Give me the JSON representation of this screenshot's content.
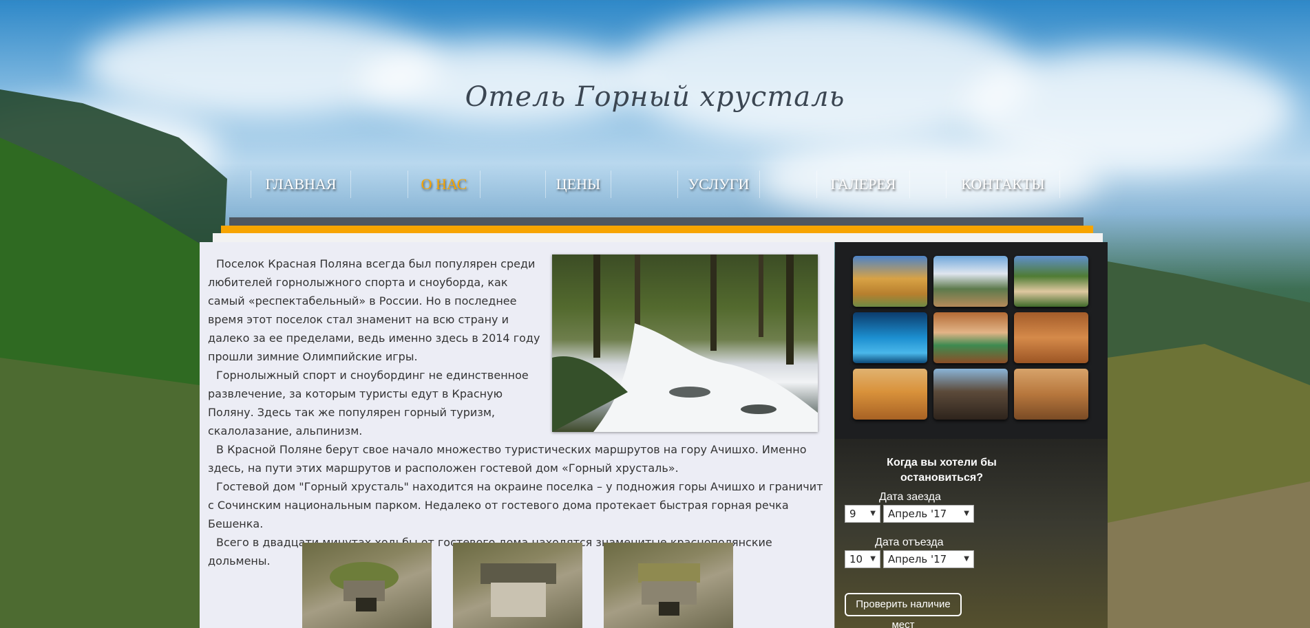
{
  "site": {
    "logo_text": "Отель Горный хрусталь"
  },
  "nav": {
    "items": [
      {
        "label": "ГЛАВНАЯ",
        "active": false
      },
      {
        "label": "О НАС",
        "active": true
      },
      {
        "label": "ЦЕНЫ",
        "active": false
      },
      {
        "label": "УСЛУГИ",
        "active": false
      },
      {
        "label": "ГАЛЕРЕЯ",
        "active": false
      },
      {
        "label": "КОНТАКТЫ",
        "active": false
      }
    ]
  },
  "colors": {
    "accent": "#f7a400",
    "bar_grey": "#4e5660",
    "content_bg": "#ecedf5",
    "sidebar_bg": "#1d1e20"
  },
  "article": {
    "paragraphs": [
      "Поселок Красная Поляна всегда был популярен среди любителей горнолыжного спорта и сноуборда, как самый «респектабельный» в России. Но в последнее время этот поселок стал знаменит на всю страну и далеко за ее пределами, ведь именно здесь в 2014 году прошли зимние Олимпийские игры.",
      "Горнолыжный спорт и сноубординг не единственное развлечение, за которым туристы едут в Красную Поляну. Здесь так же популярен горный туризм, скалолазание, альпинизм.",
      "В Красной Поляне берут свое начало множество туристических маршрутов на гору Ачишхо. Именно здесь, на пути этих маршрутов и расположен гостевой дом «Горный хрусталь».",
      "Гостевой дом \"Горный хрусталь\" находится на окраине поселка – у подножия горы Ачишхо и граничит с Сочинским национальным парком. Недалеко от гостевого дома протекает быстрая горная речка Бешенка.",
      "Всего в двадцати минутах ходьбы от гостевого дома находятся знаменитые краснополянские дольмены."
    ]
  },
  "booking": {
    "title": "Когда вы хотели бы остановиться?",
    "checkin_label": "Дата заезда",
    "checkin_day": "9",
    "checkin_month": "Апрель '17",
    "checkout_label": "Дата отъезда",
    "checkout_day": "10",
    "checkout_month": "Апрель '17",
    "button_label": "Проверить наличие мест"
  }
}
